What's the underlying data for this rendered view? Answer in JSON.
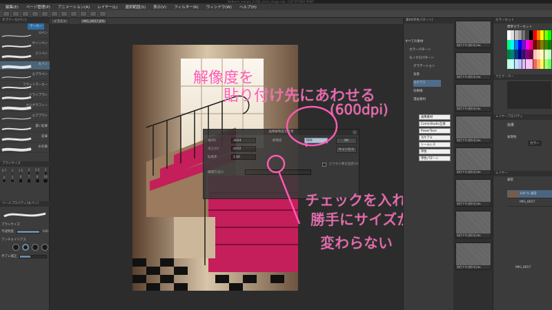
{
  "window": {
    "title": "NoName_sample_ICARE_stock_image.clip - CLIP STUDIO PAINT"
  },
  "menu": [
    "編集(E)",
    "ページ管理(P)",
    "アニメーション(A)",
    "レイヤー(L)",
    "選択範囲(S)",
    "表示(V)",
    "フィルター(R)",
    "ウィンドウ(W)",
    "ヘルプ(H)"
  ],
  "tabs": {
    "canvas_tab": "IMG_6657.JPG",
    "left_tab": "イラスト"
  },
  "left_panel": {
    "header": "サブツール[ペン]",
    "active_tab": "マーカー",
    "brushes": [
      "Gペン",
      "サインペン",
      "ミリペン",
      "丸ペン",
      "カブラペン",
      "フラットマーカー",
      "ドライブラシ",
      "カリグラフィー",
      "エアブラシ",
      "濃い鉛筆",
      "鉛筆",
      "水彩筆"
    ],
    "brush_section": "ブラシサイズ",
    "sizes": [
      "0.7",
      "1",
      "1.5",
      "2",
      "2.5",
      "3",
      "4",
      "5",
      "6",
      "7",
      "8",
      "10"
    ],
    "tool_prop_header": "ツールプロパティ[丸ペン]",
    "props": {
      "brush_size_label": "ブラシサイズ",
      "brush_size": "100",
      "opacity_label": "不透明度",
      "opacity": "100",
      "aa_label": "アンチエイリアス",
      "stab_label": "手ブレ補正"
    }
  },
  "dialog": {
    "title": "画像解像度を変更",
    "width_label": "幅(W)",
    "width_value": "3024",
    "height_label": "高さ(H)",
    "height_value": "4032",
    "scale_label": "拡縮率",
    "scale_value": "1.00",
    "resolution_label": "解像度",
    "resolution_value": "600",
    "ok": "OK",
    "cancel": "キャンセル",
    "fix_pixels_label": "ピクセル数を固定(X)",
    "method_label": "補間方法(I)"
  },
  "annotations": {
    "line1": "解像度を",
    "line2": "貼り付け先にあわせる",
    "line3": "(600dpi)",
    "line4": "チェックを入れると",
    "line5": "勝手にサイズが",
    "line6": "変わらない"
  },
  "material_panel": {
    "header": "素材[単色パターン]",
    "tree": [
      "すべての素材",
      "カラーパターン",
      "モノクロパターン",
      "グラデーション",
      "背景",
      "カケアミ",
      "効果線",
      "漫画素材"
    ],
    "selected": "カケアミ",
    "tags": [
      "画像素材",
      "ComicStudio互換",
      "PowerTone",
      "カケアミ",
      "シームレス",
      "単色",
      "単色パターン"
    ],
    "thumb_labels": [
      "向けアミ(合わせ)RA",
      "向けアミ(合わせ)RA",
      "向けアミ(合わせ)RA",
      "向けアミ(合わせ)RA",
      "向けアミ(合わせ)RA",
      "向けアミ(合わせ)RA",
      "向けアミ(合わせ)RA",
      "向けアミ(合わせ)RA"
    ]
  },
  "right_panel": {
    "palette_header": "カラーセット",
    "palette_name": "標準カラーセット",
    "nav_header": "ナビゲーター",
    "layer_prop_header": "レイヤープロパティ",
    "effect_label": "効果",
    "expression_label": "表現色",
    "expression_value": "カラー",
    "layer_header": "レイヤー",
    "blend_mode": "通常",
    "layers": [
      {
        "name": "100 % 通常",
        "sub": "IMG_6657"
      },
      {
        "name": "用紙"
      }
    ],
    "search_result": "IMG_6657"
  },
  "colors": {
    "annotation": "#ff5ab3",
    "highlight": "#4b6478",
    "accent": "#2e6fa5"
  }
}
